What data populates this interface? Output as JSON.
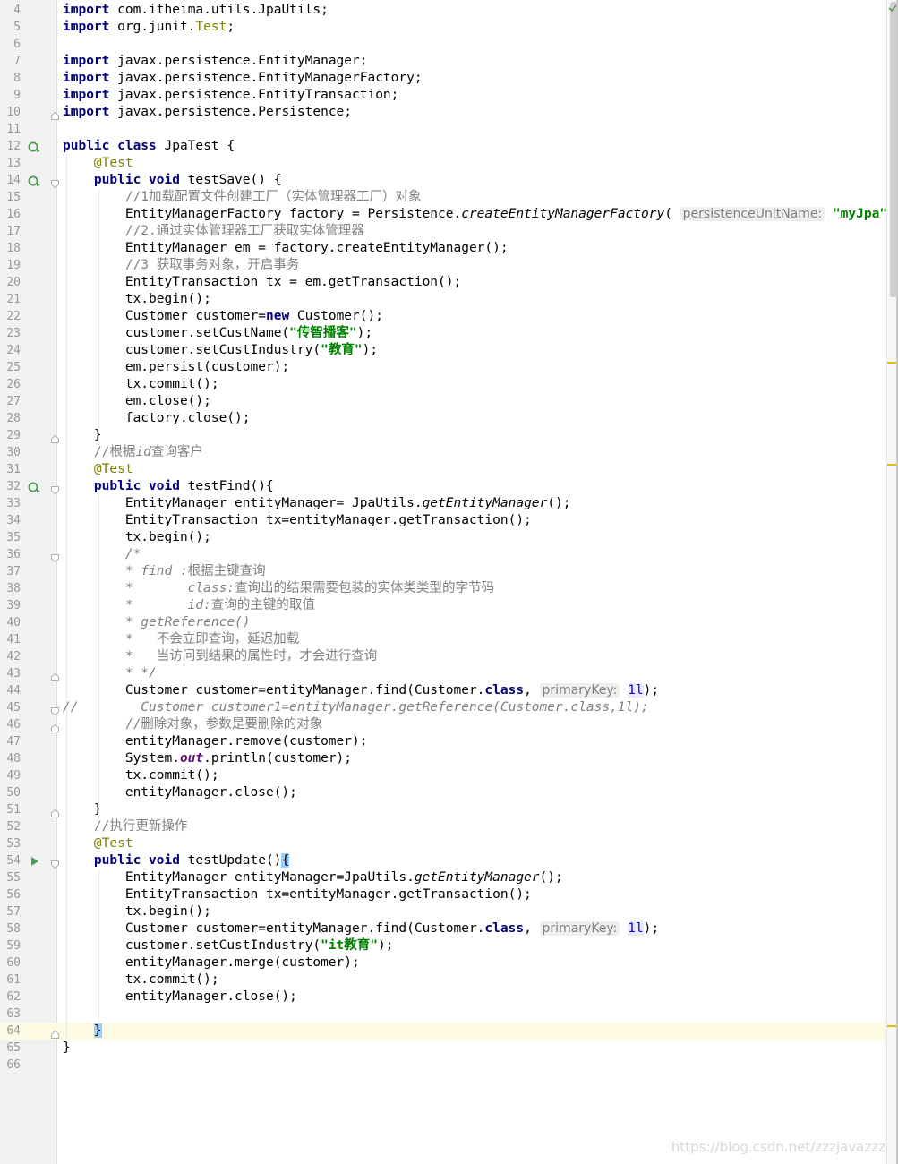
{
  "editor": {
    "current_line": 64,
    "lines": [
      {
        "n": "4",
        "html": "<span class=\"k\">import</span> com.itheima.utils.JpaUtils;"
      },
      {
        "n": "5",
        "html": "<span class=\"k\">import</span> org.junit.<span class=\"a\">Test</span>;"
      },
      {
        "n": "6",
        "html": ""
      },
      {
        "n": "7",
        "html": "<span class=\"k\">import</span> javax.persistence.EntityManager;"
      },
      {
        "n": "8",
        "html": "<span class=\"k\">import</span> javax.persistence.EntityManagerFactory;"
      },
      {
        "n": "9",
        "html": "<span class=\"k\">import</span> javax.persistence.EntityTransaction;"
      },
      {
        "n": "10",
        "html": "<span class=\"k\">import</span> javax.persistence.Persistence;",
        "fold": "end"
      },
      {
        "n": "11",
        "html": ""
      },
      {
        "n": "12",
        "html": "<span class=\"k\">public class</span> JpaTest {",
        "icon": "run-refresh"
      },
      {
        "n": "13",
        "html": "    <span class=\"a\">@Test</span>"
      },
      {
        "n": "14",
        "html": "    <span class=\"k\">public void</span> testSave() {",
        "icon": "run-refresh",
        "fold": "start"
      },
      {
        "n": "15",
        "html": "        <span class=\"c\">//1加载配置文件创建工厂（实体管理器工厂）对象</span>"
      },
      {
        "n": "16",
        "html": "        EntityManagerFactory factory = Persistence.<span class=\"m\">createEntityManagerFactory</span>( <span class=\"hint\">persistenceUnitName:</span> <span class=\"s\">\"myJpa\"</span>);"
      },
      {
        "n": "17",
        "html": "        <span class=\"c\">//2.通过实体管理器工厂获取实体管理器</span>"
      },
      {
        "n": "18",
        "html": "        EntityManager em = factory.createEntityManager();"
      },
      {
        "n": "19",
        "html": "        <span class=\"c\">//3 获取事务对象，开启事务</span>"
      },
      {
        "n": "20",
        "html": "        EntityTransaction tx = em.getTransaction();"
      },
      {
        "n": "21",
        "html": "        tx.begin();"
      },
      {
        "n": "22",
        "html": "        Customer customer=<span class=\"k\">new</span> Customer();"
      },
      {
        "n": "23",
        "html": "        customer.setCustName(<span class=\"s\">\"传智播客\"</span>);"
      },
      {
        "n": "24",
        "html": "        customer.setCustIndustry(<span class=\"s\">\"教育\"</span>);"
      },
      {
        "n": "25",
        "html": "        em.persist(customer);"
      },
      {
        "n": "26",
        "html": "        tx.commit();"
      },
      {
        "n": "27",
        "html": "        em.close();"
      },
      {
        "n": "28",
        "html": "        factory.close();"
      },
      {
        "n": "29",
        "html": "    }",
        "fold": "end"
      },
      {
        "n": "30",
        "html": "    <span class=\"c\">//根据<span class=\"m\">id</span>查询客户</span>"
      },
      {
        "n": "31",
        "html": "    <span class=\"a\">@Test</span>"
      },
      {
        "n": "32",
        "html": "    <span class=\"k\">public void</span> testFind(){",
        "icon": "run-refresh",
        "fold": "start"
      },
      {
        "n": "33",
        "html": "        EntityManager entityManager= JpaUtils.<span class=\"m\">getEntityManager</span>();"
      },
      {
        "n": "34",
        "html": "        EntityTransaction tx=entityManager.getTransaction();"
      },
      {
        "n": "35",
        "html": "        tx.begin();"
      },
      {
        "n": "36",
        "html": "        <span class=\"ci\">/*</span>",
        "fold": "start"
      },
      {
        "n": "37",
        "html": "        <span class=\"ci\">* find :</span><span class=\"c\">根据主键查询</span>"
      },
      {
        "n": "38",
        "html": "        <span class=\"ci\">*       class:</span><span class=\"c\">查询出的结果需要包装的实体类类型的字节码</span>"
      },
      {
        "n": "39",
        "html": "        <span class=\"ci\">*       id:</span><span class=\"c\">查询的主键的取值</span>"
      },
      {
        "n": "40",
        "html": "        <span class=\"ci\">* getReference()</span>"
      },
      {
        "n": "41",
        "html": "        <span class=\"ci\">*   </span><span class=\"c\">不会立即查询，延迟加载</span>"
      },
      {
        "n": "42",
        "html": "        <span class=\"ci\">*   </span><span class=\"c\">当访问到结果的属性时，才会进行查询</span>"
      },
      {
        "n": "43",
        "html": "        <span class=\"ci\">* */</span>",
        "fold": "end"
      },
      {
        "n": "44",
        "html": "        Customer customer=entityManager.find(Customer.<span class=\"k\">class</span>, <span class=\"hint\">primaryKey:</span> <span class=\"n hl\">1l</span>);"
      },
      {
        "n": "45",
        "html": "<span class=\"ci\">//        Customer customer1=entityManager.getReference(Customer.class,1l);</span>",
        "fold": "start"
      },
      {
        "n": "46",
        "html": "        <span class=\"c\">//删除对象，参数是要删除的对象</span>",
        "fold": "end"
      },
      {
        "n": "47",
        "html": "        entityManager.remove(customer);"
      },
      {
        "n": "48",
        "html": "        System.<span class=\"f\">out</span>.println(customer);"
      },
      {
        "n": "49",
        "html": "        tx.commit();"
      },
      {
        "n": "50",
        "html": "        entityManager.close();"
      },
      {
        "n": "51",
        "html": "    }",
        "fold": "end"
      },
      {
        "n": "52",
        "html": "    <span class=\"c\">//执行更新操作</span>"
      },
      {
        "n": "53",
        "html": "    <span class=\"a\">@Test</span>"
      },
      {
        "n": "54",
        "html": "    <span class=\"k\">public void</span> testUpdate()<span class=\"brace\">{</span>",
        "icon": "run",
        "fold": "start"
      },
      {
        "n": "55",
        "html": "        EntityManager entityManager=JpaUtils.<span class=\"m\">getEntityManager</span>();"
      },
      {
        "n": "56",
        "html": "        EntityTransaction tx=entityManager.getTransaction();"
      },
      {
        "n": "57",
        "html": "        tx.begin();"
      },
      {
        "n": "58",
        "html": "        Customer customer=entityManager.find(Customer.<span class=\"k\">class</span>, <span class=\"hint\">primaryKey:</span> <span class=\"n hl\">1l</span>);"
      },
      {
        "n": "59",
        "html": "        customer.setCustIndustry(<span class=\"s\">\"it教育\"</span>);"
      },
      {
        "n": "60",
        "html": "        entityManager.merge(customer);"
      },
      {
        "n": "61",
        "html": "        tx.commit();"
      },
      {
        "n": "62",
        "html": "        entityManager.close();"
      },
      {
        "n": "63",
        "html": ""
      },
      {
        "n": "64",
        "html": "    <span class=\"brace\">}</span>",
        "fold": "end"
      },
      {
        "n": "65",
        "html": "}"
      },
      {
        "n": "66",
        "html": ""
      }
    ]
  },
  "scrollbar": {
    "marker_lines": [
      25,
      31,
      64
    ]
  },
  "watermark": "https://blog.csdn.net/zzzjavazzz",
  "colors": {
    "keyword": "#000080",
    "annotation": "#808000",
    "string": "#008000",
    "comment": "#808080",
    "marker": "#e0c000",
    "current_line": "#fffae3"
  }
}
